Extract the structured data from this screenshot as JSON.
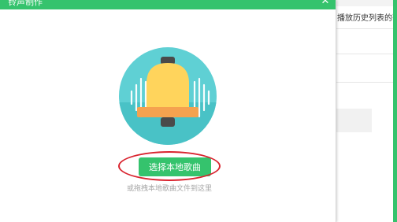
{
  "dialog": {
    "title": "铃声制作",
    "close_icon": "close-icon",
    "illustration_icon": "bell-icon",
    "select_button_label": "选择本地歌曲",
    "hint_text": "或拖拽本地歌曲文件到这里",
    "accent_color": "#35c36d",
    "highlight_color": "#d9232e"
  },
  "background_window": {
    "text": "播放历史列表的歌曲"
  }
}
